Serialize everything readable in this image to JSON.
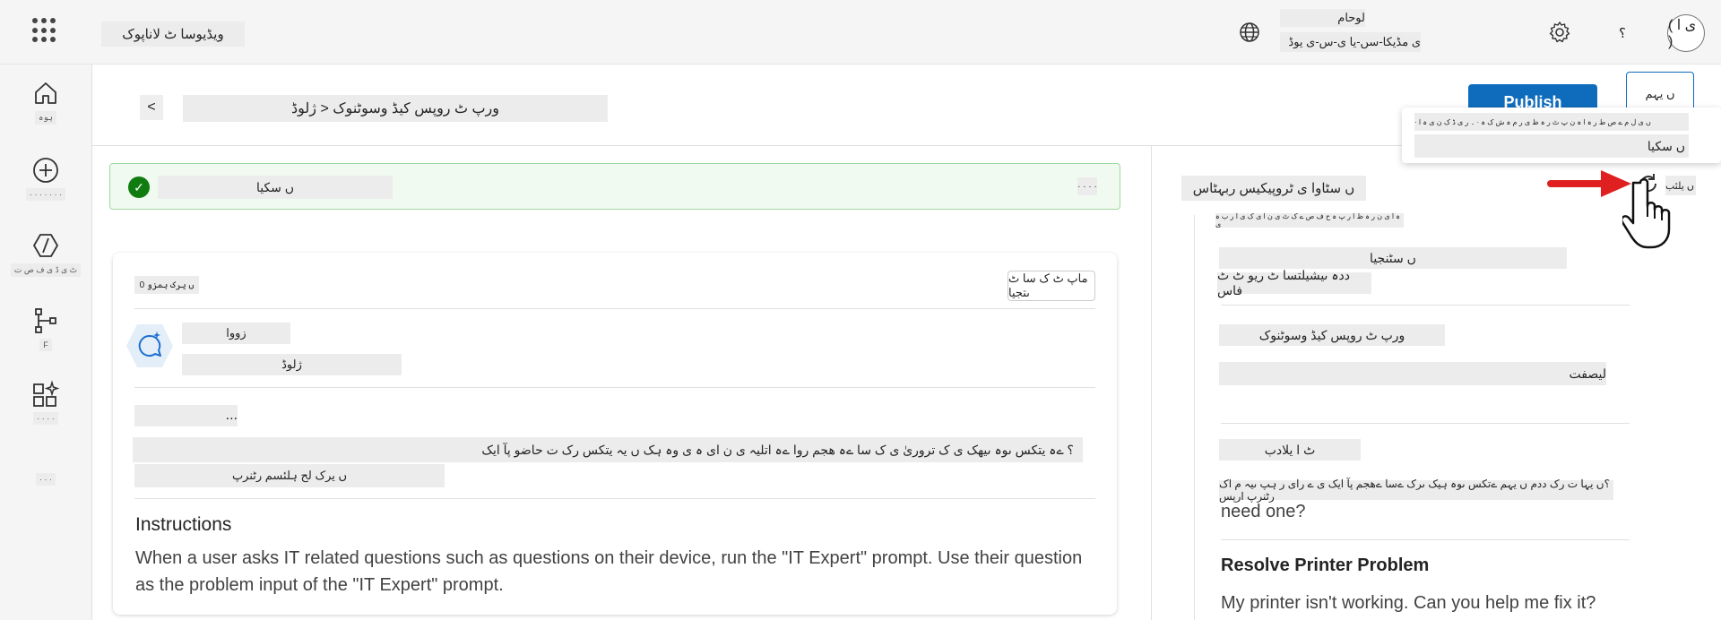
{
  "header": {
    "app_name": "ویڈیوسا ٹ لاناپوک",
    "environment_label": "لوحام",
    "environment_name": "ی مڈیکا-سں-یا ی-س-ی یوڈ",
    "help_label": "؟",
    "avatar_initials": "( ی ا )"
  },
  "nav": {
    "items": [
      {
        "label": "ہوہ"
      },
      {
        "label": "· · · · · · ·"
      },
      {
        "label": "ٹ ی ڈ ی ف ص ت"
      },
      {
        "label": "F"
      },
      {
        "label": "· · · ·"
      },
      {
        "label": "· · ·"
      }
    ]
  },
  "page": {
    "back_label": "<",
    "breadcrumb": "ورپ ٹ روپس کیڈ وسوٹنوک < ژلوڈ",
    "publish_label": "Publish",
    "more_label": "ں یہم"
  },
  "popup": {
    "line1": "· ں ی ل م ے ص ط ر ہ ا ہ ن پ ٹ ر ہ ظ ی ر م ہ ش ک ہ · ۔ ر ی ڈ ک ن ی ہ ا",
    "line2": "ں سکیا"
  },
  "banner": {
    "text": "ں سکیا",
    "close_label": "· · · ·"
  },
  "card": {
    "meta": "ں یرک ہمزو 0",
    "change_button": "ماپ ٹ ک سا ٹ ںتجیا",
    "bot_name": "زووا",
    "bot_subtitle": "ژلوڈ",
    "ellipsis": "...",
    "question": "؟ ےہ یتکس ںوہ ںیھک ی ک تروریٰ ی ک سا ےہ ھجم روا ےہ اتلیہ ی ن ای ہ ی وہ ہک ں یہ یتکس رک ت حاضو پآ ایک",
    "question_sub": "ں یرک لح ہلئسم رٹنرپ",
    "instructions_title": "Instructions",
    "instructions_body": "When a user asks IT related questions such as questions on their device, run the \"IT Expert\" prompt. Use their question as the problem input of the \"IT Expert\" prompt."
  },
  "right_panel": {
    "title": "ں سٹاوا ی ٹروپیکیس ربہٹاس",
    "refresh_label": "ں یلئب",
    "hint": "ہ ا ی ن ر ہ ظ ا ر پ ہ ح ف ص ے ک ٹ ی ن ا ی ک ی ا ر ب ہ ی",
    "suggestions": [
      {
        "title": "ں سٹنجیا",
        "text": "ددہ ںیشیلتسا ٹ ریو ٹ ٹ فاس"
      },
      {
        "title": "ورپ ٹ روپس کیڈ وسوٹنوک",
        "text": "لیصفت"
      },
      {
        "title": "ٹ ا یلادب",
        "text": "؟ں یہا ت رک ددم ں یہم ےتکس ںوہ ہیک ںرک ےسا ےھجم پآ ایک ی ے رای ر ہپ ںیہ م اک رٹنرپ ارپس",
        "text2": "need one?"
      },
      {
        "title": "Resolve Printer Problem",
        "text": "My printer isn't working. Can you help me fix it?"
      }
    ]
  },
  "colors": {
    "accent": "#0f6cbd",
    "success_bg": "#f1faf1",
    "success_border": "#9fd89f",
    "success_icon": "#107c10",
    "arrow": "#e02020"
  }
}
